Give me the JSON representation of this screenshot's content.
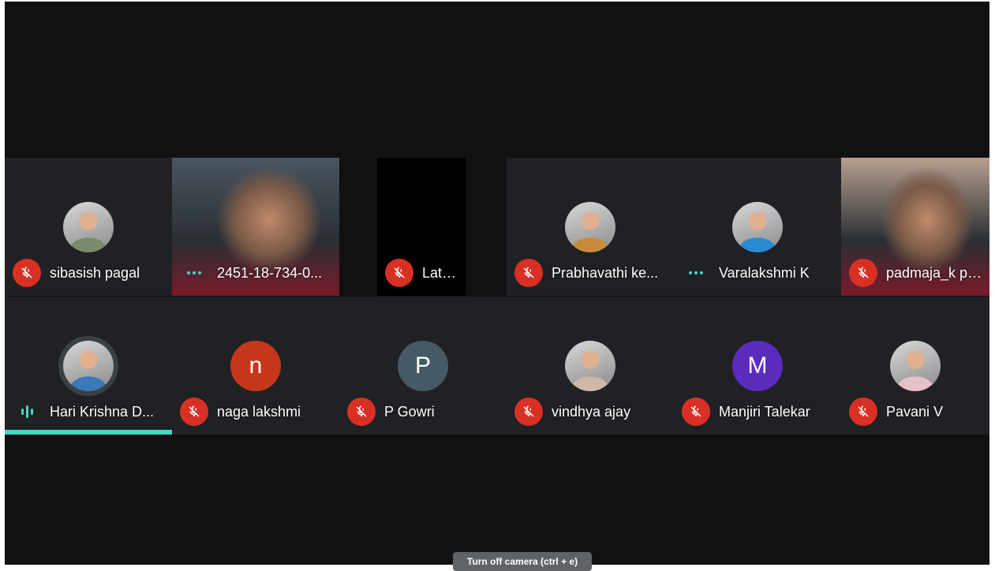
{
  "participants": [
    {
      "name": "sibasish pagal",
      "status": "muted",
      "media": "avatar-photo",
      "avatar_color": "#7a8a6a"
    },
    {
      "name": "2451-18-734-0...",
      "status": "talking-dots",
      "media": "video",
      "avatar_color": "#4a5560"
    },
    {
      "name": "Latha N",
      "status": "muted",
      "media": "black-video",
      "avatar_color": "#000000"
    },
    {
      "name": "Prabhavathi ke...",
      "status": "muted",
      "media": "avatar-photo",
      "avatar_color": "#c98a3a"
    },
    {
      "name": "Varalakshmi K",
      "status": "talking-dots",
      "media": "avatar-photo",
      "avatar_color": "#2a8ad0"
    },
    {
      "name": "padmaja_k pa...",
      "status": "muted",
      "media": "video",
      "avatar_color": "#b8a090"
    },
    {
      "name": "Hari Krishna D...",
      "status": "speaking",
      "media": "avatar-photo",
      "avatar_color": "#3a7ab8"
    },
    {
      "name": "naga lakshmi",
      "status": "muted",
      "media": "initial",
      "initial": "n",
      "avatar_color": "#c5371b"
    },
    {
      "name": "P Gowri",
      "status": "muted",
      "media": "initial",
      "initial": "P",
      "avatar_color": "#455a64"
    },
    {
      "name": "vindhya ajay",
      "status": "muted",
      "media": "avatar-photo",
      "avatar_color": "#d0b8a8"
    },
    {
      "name": "Manjiri Talekar",
      "status": "muted",
      "media": "initial",
      "initial": "M",
      "avatar_color": "#5b2bbd"
    },
    {
      "name": "Pavani V",
      "status": "muted",
      "media": "avatar-photo",
      "avatar_color": "#e8c0c8"
    }
  ],
  "tooltip": "Turn off camera (ctrl + e)",
  "colors": {
    "mute_red": "#d93025",
    "active_teal": "#3ddbc6",
    "tile_bg": "#202124"
  }
}
